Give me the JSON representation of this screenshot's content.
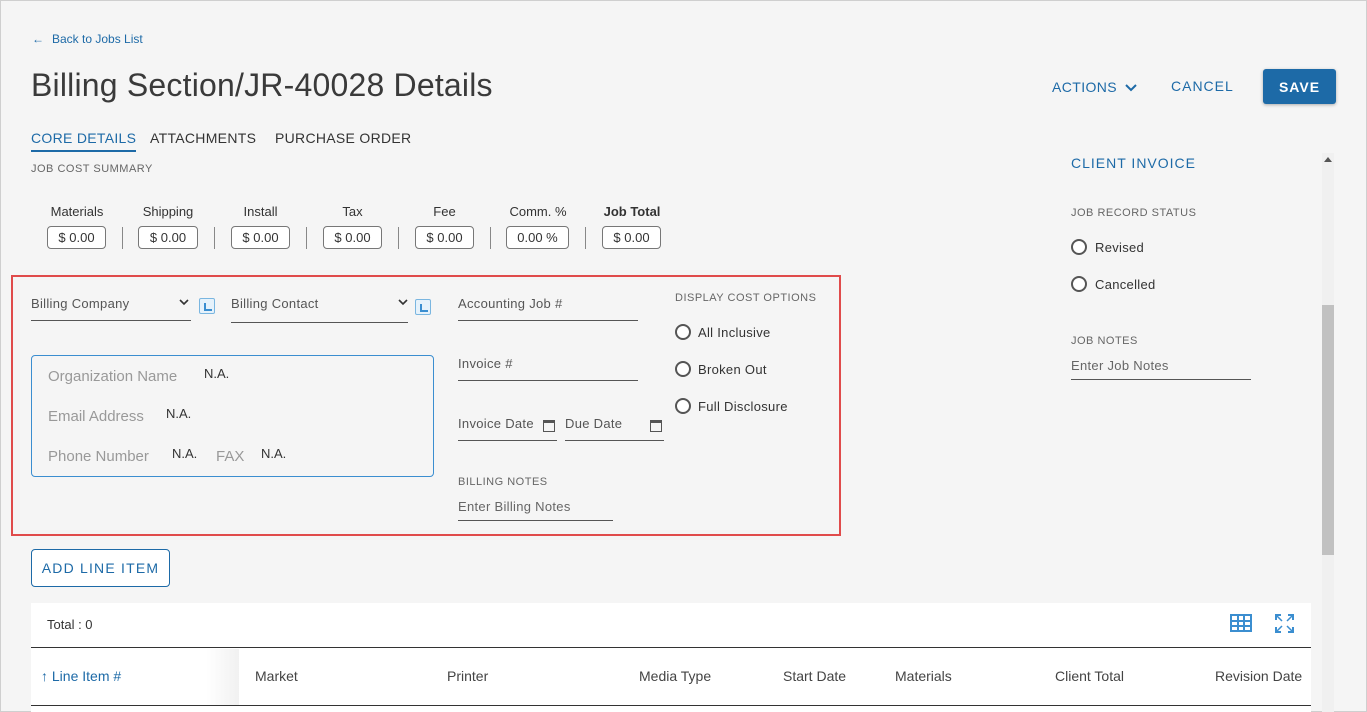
{
  "nav": {
    "back_label": "Back to Jobs List"
  },
  "header": {
    "title": "Billing Section/JR-40028 Details",
    "actions_label": "ACTIONS",
    "cancel_label": "CANCEL",
    "save_label": "SAVE"
  },
  "tabs": [
    {
      "label": "CORE DETAILS",
      "active": true
    },
    {
      "label": "ATTACHMENTS",
      "active": false
    },
    {
      "label": "PURCHASE ORDER",
      "active": false
    }
  ],
  "job_cost_summary": {
    "heading": "JOB COST SUMMARY",
    "items": [
      {
        "label": "Materials",
        "value": "$ 0.00"
      },
      {
        "label": "Shipping",
        "value": "$ 0.00"
      },
      {
        "label": "Install",
        "value": "$ 0.00"
      },
      {
        "label": "Tax",
        "value": "$ 0.00"
      },
      {
        "label": "Fee",
        "value": "$ 0.00"
      },
      {
        "label": "Comm. %",
        "value": "0.00 %"
      },
      {
        "label": "Job Total",
        "value": "$ 0.00"
      }
    ]
  },
  "billing": {
    "company_label": "Billing Company",
    "contact_label": "Billing Contact",
    "org_name_label": "Organization Name",
    "org_name_value": "N.A.",
    "email_label": "Email Address",
    "email_value": "N.A.",
    "phone_label": "Phone Number",
    "phone_value": "N.A.",
    "fax_label": "FAX",
    "fax_value": "N.A.",
    "accounting_job_label": "Accounting Job #",
    "invoice_label": "Invoice #",
    "invoice_date_label": "Invoice Date",
    "due_date_label": "Due Date",
    "billing_notes_heading": "BILLING NOTES",
    "billing_notes_placeholder": "Enter Billing Notes",
    "display_cost_heading": "DISPLAY COST OPTIONS",
    "display_cost_options": [
      "All Inclusive",
      "Broken Out",
      "Full Disclosure"
    ]
  },
  "client_invoice": {
    "heading": "CLIENT INVOICE",
    "record_status_heading": "JOB RECORD STATUS",
    "record_status_options": [
      "Revised",
      "Cancelled"
    ],
    "job_notes_heading": "JOB NOTES",
    "job_notes_placeholder": "Enter Job Notes"
  },
  "line_items": {
    "add_button_label": "ADD LINE ITEM",
    "total_label": "Total : 0",
    "columns": [
      "Line Item #",
      "Market",
      "Printer",
      "Media Type",
      "Start Date",
      "Materials",
      "Client Total",
      "Revision Date"
    ]
  },
  "colors": {
    "accent": "#1d6aa7",
    "highlight_border": "#e04b4b"
  }
}
